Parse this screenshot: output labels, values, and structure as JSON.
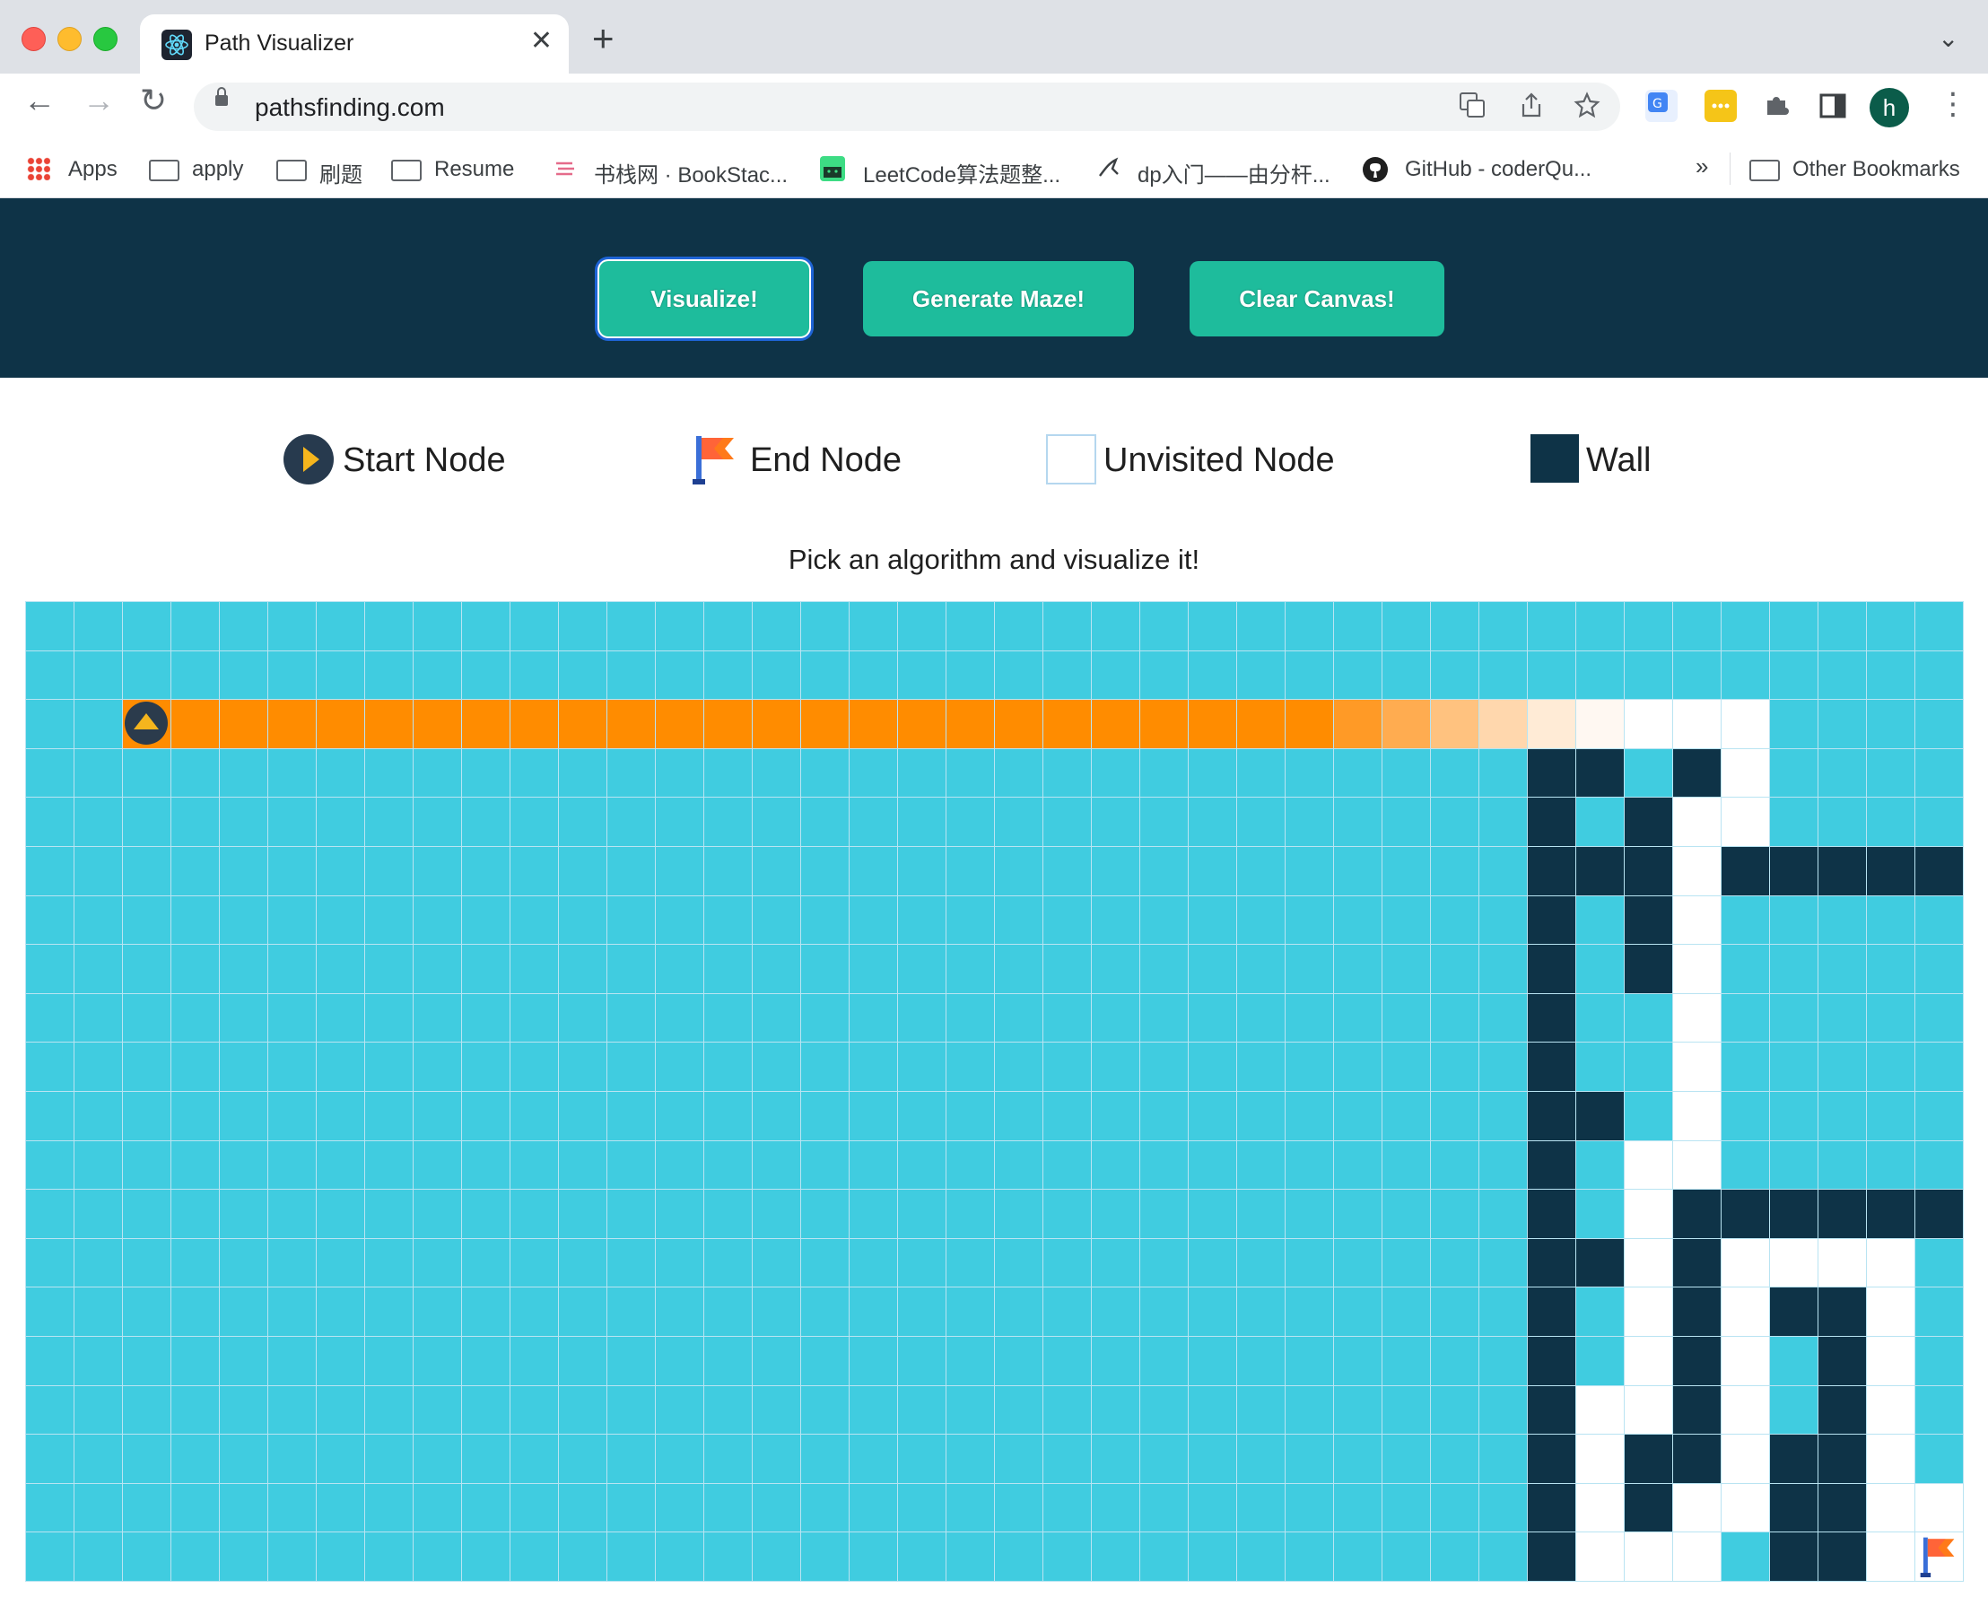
{
  "browser": {
    "tab_title": "Path Visualizer",
    "tab_close": "✕",
    "new_tab": "+",
    "url": "pathsfinding.com",
    "profile_initial": "h",
    "bookmarks": [
      {
        "label": "Apps",
        "icon": "apps-grid-icon"
      },
      {
        "label": "apply",
        "icon": "folder-icon"
      },
      {
        "label": "刷题",
        "icon": "folder-icon"
      },
      {
        "label": "Resume",
        "icon": "folder-icon"
      },
      {
        "label": "书栈网 · BookStac...",
        "icon": "bookstack-icon"
      },
      {
        "label": "LeetCode算法题整...",
        "icon": "android-icon"
      },
      {
        "label": "dp入门——由分杆...",
        "icon": "bird-icon"
      },
      {
        "label": "GitHub - coderQu...",
        "icon": "github-icon"
      }
    ],
    "bookmarks_overflow": "»",
    "other_bookmarks": "Other Bookmarks"
  },
  "header": {
    "visualize_label": "Visualize!",
    "maze_label": "Generate Maze!",
    "clear_label": "Clear Canvas!",
    "background": "#0e3347",
    "button_color": "#1ebc9c"
  },
  "legend": {
    "start": "Start Node",
    "end": "End Node",
    "unvisited": "Unvisited Node",
    "wall": "Wall"
  },
  "instruction": "Pick an algorithm and visualize it!",
  "grid": {
    "rows": 20,
    "cols": 40,
    "colors": {
      "visited": "#40cce0",
      "wall": "#0e3347",
      "unvisited": "#ffffff",
      "path": "#ff8c00"
    },
    "start": [
      2,
      2
    ],
    "end": [
      19,
      39
    ],
    "path_row": 2,
    "path_cols": [
      3,
      30
    ],
    "path_fade_cols": {
      "27": "p1",
      "28": "p2",
      "29": "p3",
      "30": "p4",
      "31": "p5",
      "32": "p6"
    },
    "walls": [
      [
        3,
        31
      ],
      [
        3,
        32
      ],
      [
        3,
        34
      ],
      [
        4,
        31
      ],
      [
        4,
        33
      ],
      [
        5,
        31
      ],
      [
        5,
        32
      ],
      [
        5,
        33
      ],
      [
        5,
        35
      ],
      [
        5,
        36
      ],
      [
        5,
        37
      ],
      [
        5,
        38
      ],
      [
        5,
        39
      ],
      [
        6,
        31
      ],
      [
        6,
        33
      ],
      [
        7,
        31
      ],
      [
        7,
        33
      ],
      [
        8,
        31
      ],
      [
        9,
        31
      ],
      [
        10,
        31
      ],
      [
        10,
        32
      ],
      [
        11,
        31
      ],
      [
        12,
        31
      ],
      [
        12,
        34
      ],
      [
        12,
        35
      ],
      [
        12,
        36
      ],
      [
        12,
        37
      ],
      [
        12,
        38
      ],
      [
        12,
        39
      ],
      [
        13,
        31
      ],
      [
        13,
        32
      ],
      [
        13,
        34
      ],
      [
        14,
        31
      ],
      [
        14,
        34
      ],
      [
        14,
        36
      ],
      [
        14,
        37
      ],
      [
        15,
        31
      ],
      [
        15,
        34
      ],
      [
        15,
        37
      ],
      [
        16,
        31
      ],
      [
        16,
        34
      ],
      [
        16,
        37
      ],
      [
        17,
        31
      ],
      [
        17,
        33
      ],
      [
        17,
        34
      ],
      [
        17,
        36
      ],
      [
        17,
        37
      ],
      [
        18,
        31
      ],
      [
        18,
        33
      ],
      [
        18,
        36
      ],
      [
        18,
        37
      ],
      [
        19,
        31
      ],
      [
        19,
        36
      ],
      [
        19,
        37
      ]
    ],
    "whites": [
      [
        2,
        33
      ],
      [
        2,
        34
      ],
      [
        2,
        35
      ],
      [
        3,
        35
      ],
      [
        4,
        34
      ],
      [
        4,
        35
      ],
      [
        5,
        34
      ],
      [
        6,
        34
      ],
      [
        7,
        34
      ],
      [
        8,
        34
      ],
      [
        9,
        34
      ],
      [
        10,
        34
      ],
      [
        11,
        33
      ],
      [
        11,
        34
      ],
      [
        12,
        33
      ],
      [
        13,
        33
      ],
      [
        13,
        35
      ],
      [
        13,
        36
      ],
      [
        13,
        37
      ],
      [
        13,
        38
      ],
      [
        14,
        33
      ],
      [
        14,
        35
      ],
      [
        14,
        38
      ],
      [
        15,
        33
      ],
      [
        15,
        35
      ],
      [
        15,
        38
      ],
      [
        16,
        32
      ],
      [
        16,
        33
      ],
      [
        16,
        35
      ],
      [
        16,
        38
      ],
      [
        17,
        32
      ],
      [
        17,
        35
      ],
      [
        17,
        38
      ],
      [
        18,
        32
      ],
      [
        18,
        34
      ],
      [
        18,
        35
      ],
      [
        18,
        38
      ],
      [
        18,
        39
      ],
      [
        19,
        32
      ],
      [
        19,
        33
      ],
      [
        19,
        34
      ],
      [
        19,
        38
      ],
      [
        19,
        39
      ]
    ]
  }
}
